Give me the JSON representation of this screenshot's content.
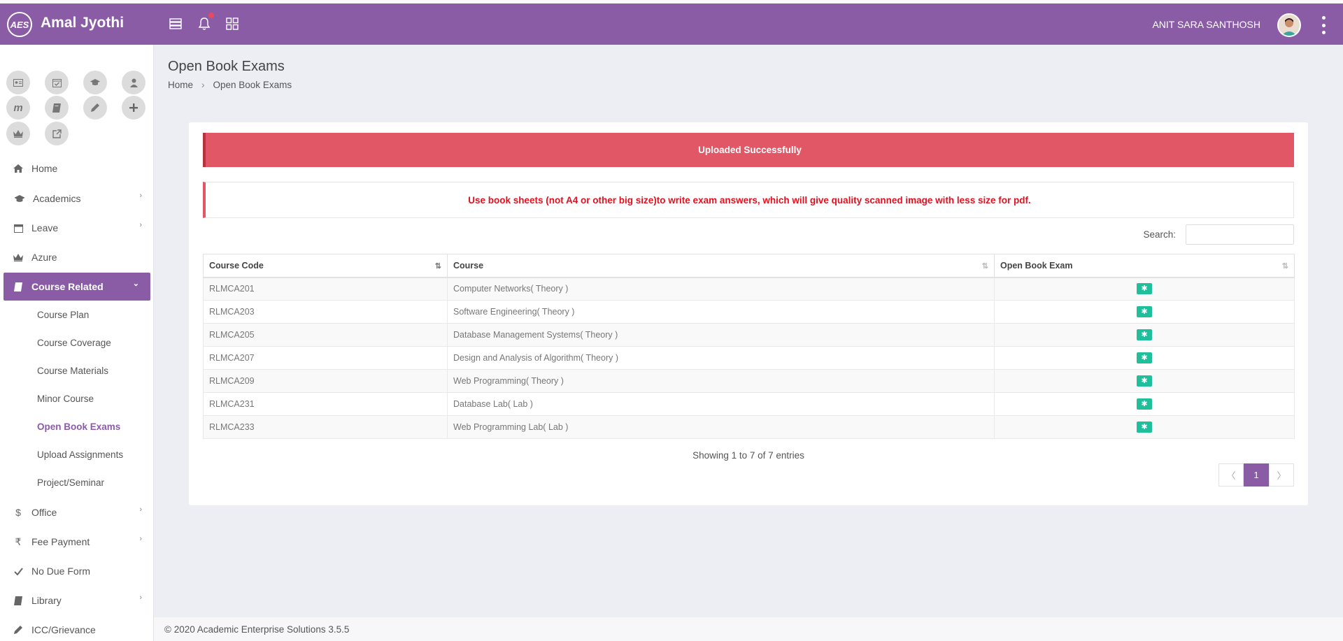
{
  "header": {
    "logo_text": "AES",
    "brand": "Amal Jyothi",
    "user_name": "ANIT SARA SANTHOSH",
    "color": "#8a5ca6"
  },
  "quick_links": [
    {
      "icon": "id-card-icon"
    },
    {
      "icon": "calendar-check-icon"
    },
    {
      "icon": "graduation-cap-icon"
    },
    {
      "icon": "user-tie-icon"
    },
    {
      "icon": "moodle-icon",
      "glyph": "m"
    },
    {
      "icon": "book-icon"
    },
    {
      "icon": "pencil-icon"
    },
    {
      "icon": "plus-icon"
    },
    {
      "icon": "crown-icon"
    },
    {
      "icon": "external-link-icon"
    }
  ],
  "sidebar": {
    "items": [
      {
        "label": "Home",
        "icon": "home-icon"
      },
      {
        "label": "Academics",
        "icon": "graduation-cap-icon",
        "has_submenu": true
      },
      {
        "label": "Leave",
        "icon": "calendar-icon",
        "has_submenu": true
      },
      {
        "label": "Azure",
        "icon": "crown-icon"
      },
      {
        "label": "Course Related",
        "icon": "book-icon",
        "active": true,
        "expanded": true
      },
      {
        "label": "Office",
        "icon": "dollar-icon",
        "glyph": "$",
        "has_submenu": true
      },
      {
        "label": "Fee Payment",
        "icon": "rupee-icon",
        "glyph": "₹",
        "has_submenu": true
      },
      {
        "label": "No Due Form",
        "icon": "check-icon"
      },
      {
        "label": "Library",
        "icon": "book-icon",
        "has_submenu": true
      },
      {
        "label": "ICC/Grievance",
        "icon": "pencil-icon"
      }
    ],
    "course_related_sub": [
      {
        "label": "Course Plan"
      },
      {
        "label": "Course Coverage"
      },
      {
        "label": "Course Materials"
      },
      {
        "label": "Minor Course"
      },
      {
        "label": "Open Book Exams",
        "active": true
      },
      {
        "label": "Upload Assignments"
      },
      {
        "label": "Project/Seminar"
      }
    ]
  },
  "page": {
    "title": "Open Book Exams",
    "breadcrumb": [
      "Home",
      "Open Book Exams"
    ]
  },
  "alerts": {
    "success": "Uploaded Successfully",
    "notice": "Use book sheets (not A4 or other big size)to write exam answers, which will give quality scanned image with less size for pdf."
  },
  "search": {
    "label": "Search:",
    "value": ""
  },
  "table": {
    "columns": [
      "Course Code",
      "Course",
      "Open Book Exam"
    ],
    "rows": [
      {
        "code": "RLMCA201",
        "course": "Computer Networks( Theory )"
      },
      {
        "code": "RLMCA203",
        "course": "Software Engineering( Theory )"
      },
      {
        "code": "RLMCA205",
        "course": "Database Management Systems( Theory )"
      },
      {
        "code": "RLMCA207",
        "course": "Design and Analysis of Algorithm( Theory )"
      },
      {
        "code": "RLMCA209",
        "course": "Web Programming( Theory )"
      },
      {
        "code": "RLMCA231",
        "course": "Database Lab( Lab )"
      },
      {
        "code": "RLMCA233",
        "course": "Web Programming Lab( Lab )"
      }
    ]
  },
  "pagination": {
    "info": "Showing 1 to 7 of 7 entries",
    "prev": "〈",
    "current": "1",
    "next": "〉"
  },
  "footer": {
    "text": "© 2020 Academic Enterprise Solutions 3.5.5"
  }
}
